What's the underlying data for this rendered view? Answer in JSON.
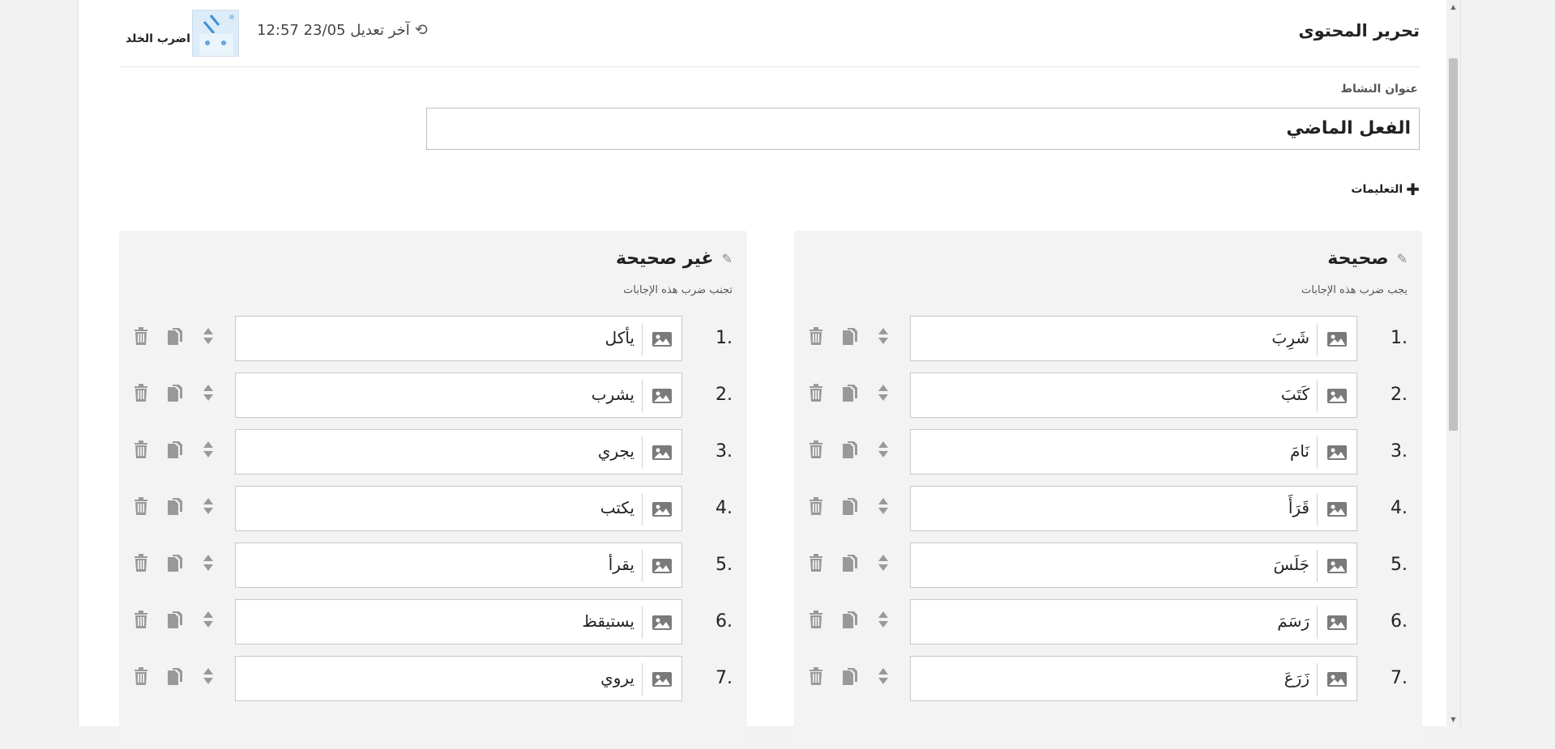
{
  "header": {
    "title": "تحرير المحتوى",
    "last_edit": "آخر تعديل 23/05 12:57",
    "user_name": "اضرب الخلد"
  },
  "activity": {
    "label": "عنوان النشاط",
    "value": "الفعل الماضي",
    "instructions_label": "التعليمات"
  },
  "correct": {
    "title": "صحيحة",
    "subtitle": "يجب ضرب هذه الإجابات",
    "items": [
      {
        "num": "1.",
        "text": "شَرِبَ"
      },
      {
        "num": "2.",
        "text": "كَتَبَ"
      },
      {
        "num": "3.",
        "text": "نَامَ"
      },
      {
        "num": "4.",
        "text": "قَرَأَ"
      },
      {
        "num": "5.",
        "text": "جَلَسَ"
      },
      {
        "num": "6.",
        "text": "رَسَمَ"
      },
      {
        "num": "7.",
        "text": "زَرَعَ"
      }
    ]
  },
  "incorrect": {
    "title": "غير صحيحة",
    "subtitle": "تجنب ضرب هذه الإجابات",
    "items": [
      {
        "num": "1.",
        "text": "يأكل"
      },
      {
        "num": "2.",
        "text": "يشرب"
      },
      {
        "num": "3.",
        "text": "يجري"
      },
      {
        "num": "4.",
        "text": "يكتب"
      },
      {
        "num": "5.",
        "text": "يقرأ"
      },
      {
        "num": "6.",
        "text": "يستيقظ"
      },
      {
        "num": "7.",
        "text": "يروي"
      }
    ]
  },
  "icons": {
    "history": "history-icon",
    "plus": "plus-icon",
    "edit": "edit-icon",
    "image": "image-icon",
    "sort": "sort-icon",
    "copy": "copy-icon",
    "trash": "trash-icon"
  }
}
